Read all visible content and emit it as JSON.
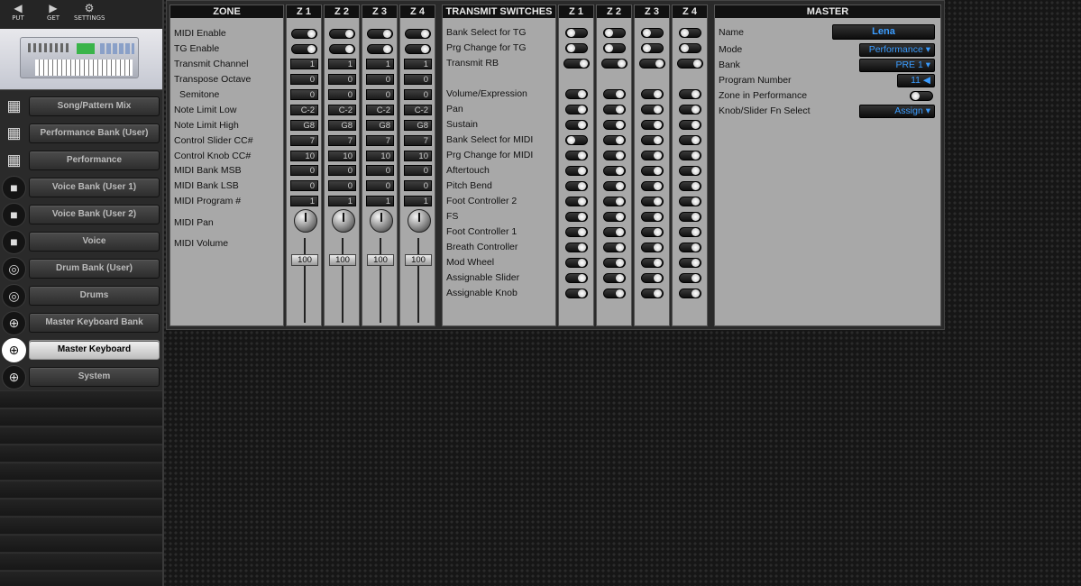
{
  "toolbar": {
    "put": "PUT",
    "get": "GET",
    "settings": "SETTINGS"
  },
  "nav": [
    {
      "label": "Song/Pattern Mix",
      "icon": "grid-icon"
    },
    {
      "label": "Performance Bank (User)",
      "icon": "grid-icon"
    },
    {
      "label": "Performance",
      "icon": "grid-icon"
    },
    {
      "label": "Voice Bank (User 1)",
      "icon": "voice-icon"
    },
    {
      "label": "Voice Bank (User 2)",
      "icon": "voice-icon"
    },
    {
      "label": "Voice",
      "icon": "voice-icon"
    },
    {
      "label": "Drum Bank (User)",
      "icon": "drum-icon"
    },
    {
      "label": "Drums",
      "icon": "drum-icon"
    },
    {
      "label": "Master Keyboard Bank",
      "icon": "globe-icon"
    },
    {
      "label": "Master Keyboard",
      "icon": "globe-icon",
      "active": true
    },
    {
      "label": "System",
      "icon": "globe-icon"
    }
  ],
  "zone": {
    "title": "ZONE",
    "headers": [
      "Z 1",
      "Z 2",
      "Z 3",
      "Z 4"
    ],
    "rows": [
      "MIDI Enable",
      "TG Enable",
      "Transmit Channel",
      "Transpose Octave",
      "Semitone",
      "Note Limit Low",
      "Note Limit High",
      "Control Slider CC#",
      "Control Knob CC#",
      "MIDI Bank MSB",
      "MIDI Bank LSB",
      "MIDI Program #",
      "MIDI Pan",
      "MIDI Volume"
    ],
    "values": [
      [
        "1",
        "1",
        "1",
        "1"
      ],
      [
        "0",
        "0",
        "0",
        "0"
      ],
      [
        "0",
        "0",
        "0",
        "0"
      ],
      [
        "C-2",
        "C-2",
        "C-2",
        "C-2"
      ],
      [
        "G8",
        "G8",
        "G8",
        "G8"
      ],
      [
        "7",
        "7",
        "7",
        "7"
      ],
      [
        "10",
        "10",
        "10",
        "10"
      ],
      [
        "0",
        "0",
        "0",
        "0"
      ],
      [
        "0",
        "0",
        "0",
        "0"
      ],
      [
        "1",
        "1",
        "1",
        "1"
      ]
    ],
    "volume": [
      "100",
      "100",
      "100",
      "100"
    ]
  },
  "transmit": {
    "title": "TRANSMIT SWITCHES",
    "headers": [
      "Z 1",
      "Z 2",
      "Z 3",
      "Z 4"
    ],
    "rows": [
      "Bank Select for TG",
      "Prg Change for TG",
      "Transmit RB",
      "",
      "Volume/Expression",
      "Pan",
      "Sustain",
      "Bank Select for MIDI",
      "Prg Change for MIDI",
      "Aftertouch",
      "Pitch Bend",
      "Foot Controller 2",
      "FS",
      "Foot Controller 1",
      "Breath Controller",
      "Mod Wheel",
      "Assignable Slider",
      "Assignable Knob"
    ]
  },
  "master": {
    "title": "MASTER",
    "name_label": "Name",
    "name_value": "Lena",
    "mode_label": "Mode",
    "mode_value": "Performance",
    "bank_label": "Bank",
    "bank_value": "PRE 1",
    "program_label": "Program Number",
    "program_value": "11",
    "zone_label": "Zone in Performance",
    "knob_label": "Knob/Slider Fn Select",
    "knob_value": "Assign"
  }
}
